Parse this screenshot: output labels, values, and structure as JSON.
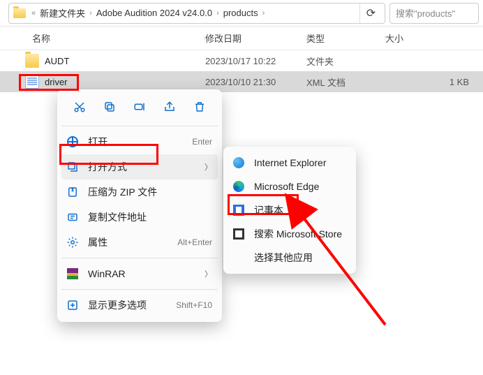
{
  "breadcrumb": {
    "prefix": "«",
    "items": [
      "新建文件夹",
      "Adobe Audition 2024 v24.0.0",
      "products"
    ]
  },
  "search": {
    "placeholder": "搜索\"products\""
  },
  "columns": {
    "name": "名称",
    "date": "修改日期",
    "type": "类型",
    "size": "大小"
  },
  "files": [
    {
      "name": "AUDT",
      "date": "2023/10/17 10:22",
      "type": "文件夹",
      "size": ""
    },
    {
      "name": "driver",
      "date": "2023/10/10 21:30",
      "type": "XML 文档",
      "size": "1 KB"
    }
  ],
  "context_menu": {
    "toolbar_icons": [
      "cut-icon",
      "copy-icon",
      "rename-icon",
      "share-icon",
      "delete-icon"
    ],
    "items": [
      {
        "icon": "globe-icon",
        "label": "打开",
        "accel": "Enter",
        "submenu": false
      },
      {
        "icon": "openwith-icon",
        "label": "打开方式",
        "accel": "",
        "submenu": true,
        "hover": true
      },
      {
        "icon": "zip-icon",
        "label": "压缩为 ZIP 文件",
        "accel": "",
        "submenu": false
      },
      {
        "icon": "copypath-icon",
        "label": "复制文件地址",
        "accel": "",
        "submenu": false
      },
      {
        "icon": "props-icon",
        "label": "属性",
        "accel": "Alt+Enter",
        "submenu": false
      },
      {
        "sep": true
      },
      {
        "icon": "winrar-icon",
        "label": "WinRAR",
        "accel": "",
        "submenu": true
      },
      {
        "sep": true
      },
      {
        "icon": "more-icon",
        "label": "显示更多选项",
        "accel": "Shift+F10",
        "submenu": false
      }
    ]
  },
  "submenu": {
    "items": [
      {
        "icon": "ie-icon",
        "label": "Internet Explorer"
      },
      {
        "icon": "edge-icon",
        "label": "Microsoft Edge"
      },
      {
        "icon": "notepad-icon",
        "label": "记事本",
        "highlight": true
      },
      {
        "icon": "store-icon",
        "label": "搜索 Microsoft Store"
      },
      {
        "icon": "",
        "label": "选择其他应用"
      }
    ]
  },
  "annotations": {
    "highlight_color": "#ff0000",
    "boxes": [
      "driver-row",
      "open-with-item",
      "notepad-item"
    ]
  }
}
